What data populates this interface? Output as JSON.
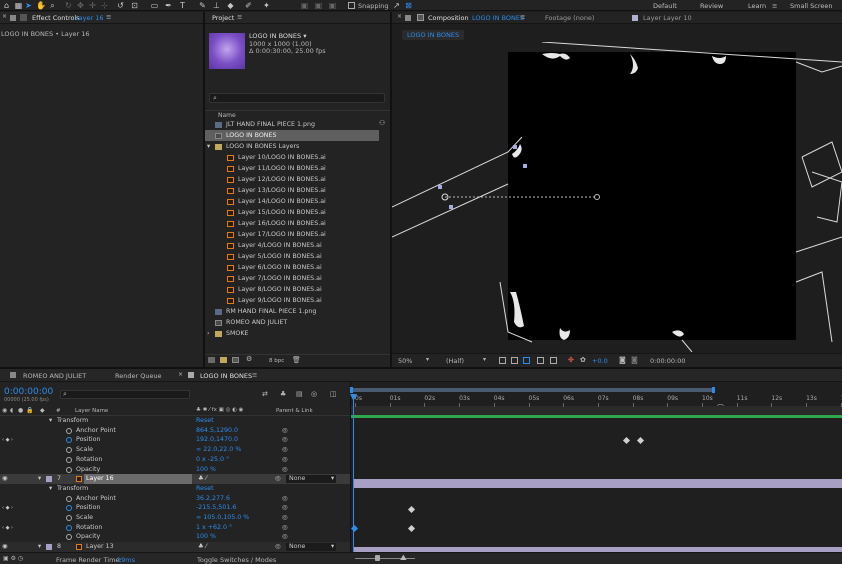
{
  "toolbar": {
    "snapping": "Snapping",
    "workspaces": [
      "Default",
      "Review",
      "Learn",
      "Small Screen"
    ],
    "active_workspace": "Learn"
  },
  "effect_controls": {
    "tab_label": "Effect Controls",
    "tab_layer": "Layer 16",
    "breadcrumb": "LOGO IN BONES • Layer 16"
  },
  "project": {
    "tab_label": "Project",
    "comp_name": "LOGO IN BONES ▾",
    "comp_size": "1000 x 1000 (1.00)",
    "comp_duration": "Δ 0:00:30:00, 25.00 fps",
    "column_name": "Name",
    "items": [
      {
        "label": "JLT HAND FINAL PIECE 1.png",
        "type": "png",
        "indent": 0
      },
      {
        "label": "LOGO IN BONES",
        "type": "comp",
        "indent": 0,
        "selected": true
      },
      {
        "label": "LOGO IN BONES Layers",
        "type": "folder",
        "indent": 0,
        "expanded": true
      },
      {
        "label": "Layer 10/LOGO IN BONES.ai",
        "type": "ai",
        "indent": 1
      },
      {
        "label": "Layer 11/LOGO IN BONES.ai",
        "type": "ai",
        "indent": 1
      },
      {
        "label": "Layer 12/LOGO IN BONES.ai",
        "type": "ai",
        "indent": 1
      },
      {
        "label": "Layer 13/LOGO IN BONES.ai",
        "type": "ai",
        "indent": 1
      },
      {
        "label": "Layer 14/LOGO IN BONES.ai",
        "type": "ai",
        "indent": 1
      },
      {
        "label": "Layer 15/LOGO IN BONES.ai",
        "type": "ai",
        "indent": 1
      },
      {
        "label": "Layer 16/LOGO IN BONES.ai",
        "type": "ai",
        "indent": 1
      },
      {
        "label": "Layer 17/LOGO IN BONES.ai",
        "type": "ai",
        "indent": 1
      },
      {
        "label": "Layer 4/LOGO IN BONES.ai",
        "type": "ai",
        "indent": 1
      },
      {
        "label": "Layer 5/LOGO IN BONES.ai",
        "type": "ai",
        "indent": 1
      },
      {
        "label": "Layer 6/LOGO IN BONES.ai",
        "type": "ai",
        "indent": 1
      },
      {
        "label": "Layer 7/LOGO IN BONES.ai",
        "type": "ai",
        "indent": 1
      },
      {
        "label": "Layer 8/LOGO IN BONES.ai",
        "type": "ai",
        "indent": 1
      },
      {
        "label": "Layer 9/LOGO IN BONES.ai",
        "type": "ai",
        "indent": 1
      },
      {
        "label": "RM HAND FINAL PIECE 1.png",
        "type": "png",
        "indent": 0
      },
      {
        "label": "ROMEO AND JULIET",
        "type": "comp",
        "indent": 0
      },
      {
        "label": "SMOKE",
        "type": "folder",
        "indent": 0
      }
    ],
    "bpc": "8 bpc"
  },
  "composition": {
    "tab_label": "Composition",
    "tab_name": "LOGO IN BONES",
    "footage_tab": "Footage (none)",
    "layer_tab": "Layer Layer 10",
    "subtab": "LOGO IN BONES",
    "zoom": "50%",
    "resolution": "(Half)",
    "exposure": "+0.0",
    "timecode": "0:00:00:00"
  },
  "timeline": {
    "tabs": [
      "ROMEO AND JULIET",
      "Render Queue",
      "LOGO IN BONES"
    ],
    "active_tab": "LOGO IN BONES",
    "current_time": "0:00:00:00",
    "fps": "00000 (25.00 fps)",
    "col_num": "#",
    "col_layer": "Layer Name",
    "col_parent": "Parent & Link",
    "ruler": [
      "0s",
      "01s",
      "02s",
      "03s",
      "04s",
      "05s",
      "06s",
      "07s",
      "08s",
      "09s",
      "10s",
      "11s",
      "12s",
      "13s",
      "14"
    ],
    "reset": "Reset",
    "transform": "Transform",
    "rows": [
      {
        "kind": "group",
        "label": "Transform",
        "reset": true
      },
      {
        "kind": "prop",
        "label": "Anchor Point",
        "value": "864.5,1290.0"
      },
      {
        "kind": "prop",
        "label": "Position",
        "value": "192.0,1470.0",
        "keyed": true
      },
      {
        "kind": "prop",
        "label": "Scale",
        "value": "∞ 22.0,22.0 %"
      },
      {
        "kind": "prop",
        "label": "Rotation",
        "value": "0 x -25.0 °"
      },
      {
        "kind": "prop",
        "label": "Opacity",
        "value": "100 %"
      },
      {
        "kind": "layer",
        "num": "7",
        "label": "Layer 16",
        "parent": "None",
        "selected": true
      },
      {
        "kind": "group",
        "label": "Transform",
        "reset": true
      },
      {
        "kind": "prop",
        "label": "Anchor Point",
        "value": "36.2,277.6"
      },
      {
        "kind": "prop",
        "label": "Position",
        "value": "-215.5,501.6",
        "keyed": true
      },
      {
        "kind": "prop",
        "label": "Scale",
        "value": "∞ 105.0,105.0 %"
      },
      {
        "kind": "prop",
        "label": "Rotation",
        "value": "1 x +62.0 °",
        "keyed": true
      },
      {
        "kind": "prop",
        "label": "Opacity",
        "value": "100 %"
      },
      {
        "kind": "layer",
        "num": "8",
        "label": "Layer 13",
        "parent": "None"
      }
    ],
    "render_label": "Frame Render Time:",
    "render_value": "19ms",
    "toggle_label": "Toggle Switches / Modes"
  }
}
